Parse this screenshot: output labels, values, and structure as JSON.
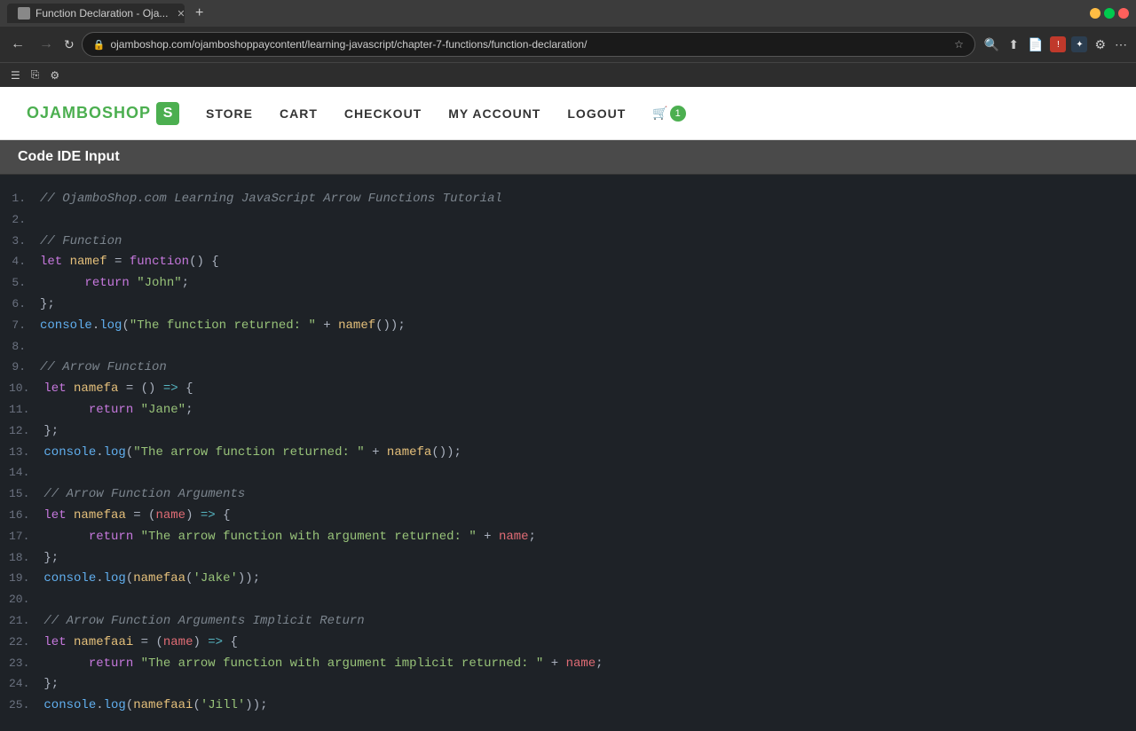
{
  "browser": {
    "tab_title": "Function Declaration - Oja...",
    "url": "ojamboshop.com/ojamboshoppaycontent/learning-javascript/chapter-7-functions/function-declaration/",
    "new_tab_label": "+",
    "nav": {
      "back_label": "←",
      "forward_label": "→",
      "reload_label": "↻"
    },
    "extensions": [
      {
        "id": "ext1",
        "label": "!"
      },
      {
        "id": "ext2",
        "label": "✦"
      }
    ]
  },
  "site": {
    "logo_text": "OJAMBOSHOP",
    "logo_icon": "S",
    "nav_items": [
      {
        "id": "store",
        "label": "STORE",
        "href": "#"
      },
      {
        "id": "cart",
        "label": "CART",
        "href": "#"
      },
      {
        "id": "checkout",
        "label": "CHECKOUT",
        "href": "#"
      },
      {
        "id": "my-account",
        "label": "MY ACCOUNT",
        "href": "#"
      },
      {
        "id": "logout",
        "label": "LOGOUT",
        "href": "#"
      }
    ],
    "cart_count": "1"
  },
  "code_section": {
    "header": "Code IDE Input"
  },
  "code_lines": [
    {
      "num": "1.",
      "content": "// OjamboShop.com Learning JavaScript Arrow Functions Tutorial",
      "type": "comment"
    },
    {
      "num": "2.",
      "content": "",
      "type": "plain"
    },
    {
      "num": "3.",
      "content": "// Function",
      "type": "comment"
    },
    {
      "num": "4.",
      "content": "let namef = function() {",
      "type": "code"
    },
    {
      "num": "5.",
      "content": "      return \"John\";",
      "type": "code"
    },
    {
      "num": "6.",
      "content": "};",
      "type": "code"
    },
    {
      "num": "7.",
      "content": "console.log(\"The function returned: \" + namef());",
      "type": "code"
    },
    {
      "num": "8.",
      "content": "",
      "type": "plain"
    },
    {
      "num": "9.",
      "content": "// Arrow Function",
      "type": "comment"
    },
    {
      "num": "10.",
      "content": "let namefa = () => {",
      "type": "code"
    },
    {
      "num": "11.",
      "content": "      return \"Jane\";",
      "type": "code"
    },
    {
      "num": "12.",
      "content": "};",
      "type": "code"
    },
    {
      "num": "13.",
      "content": "console.log(\"The arrow function returned: \" + namefa());",
      "type": "code"
    },
    {
      "num": "14.",
      "content": "",
      "type": "plain"
    },
    {
      "num": "15.",
      "content": "// Arrow Function Arguments",
      "type": "comment"
    },
    {
      "num": "16.",
      "content": "let namefaa = (name) => {",
      "type": "code"
    },
    {
      "num": "17.",
      "content": "      return \"The arrow function with argument returned: \" + name;",
      "type": "code"
    },
    {
      "num": "18.",
      "content": "};",
      "type": "code"
    },
    {
      "num": "19.",
      "content": "console.log(namefaa('Jake'));",
      "type": "code"
    },
    {
      "num": "20.",
      "content": "",
      "type": "plain"
    },
    {
      "num": "21.",
      "content": "// Arrow Function Arguments Implicit Return",
      "type": "comment"
    },
    {
      "num": "22.",
      "content": "let namefaai = (name) => {",
      "type": "code"
    },
    {
      "num": "23.",
      "content": "      return \"The arrow function with argument implicit returned: \" + name;",
      "type": "code"
    },
    {
      "num": "24.",
      "content": "};",
      "type": "code"
    },
    {
      "num": "25.",
      "content": "console.log(namefaai('Jill'));",
      "type": "code"
    }
  ]
}
